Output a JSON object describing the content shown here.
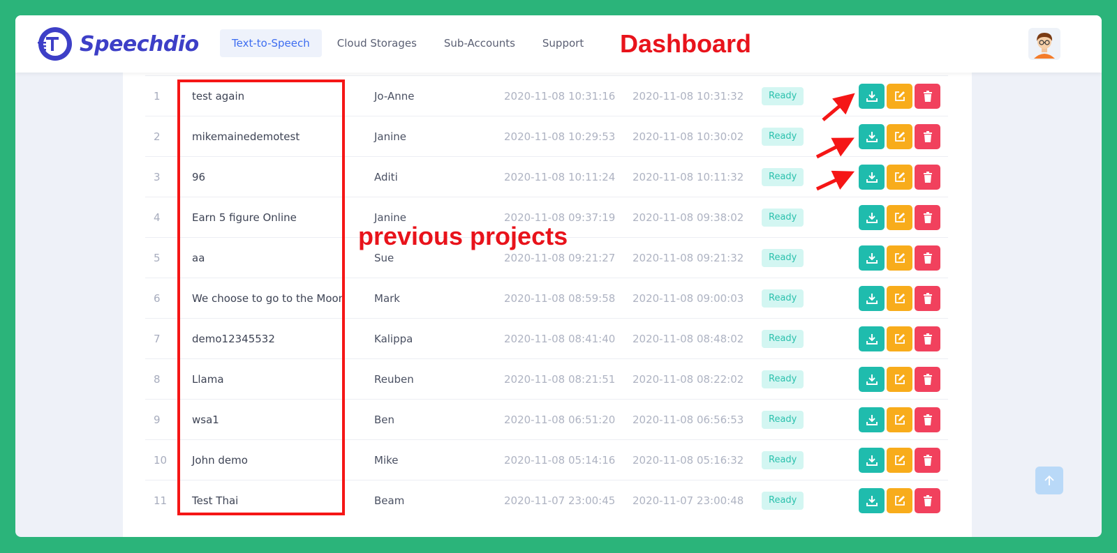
{
  "app": {
    "name": "Speechdio"
  },
  "nav": {
    "items": [
      {
        "label": "Text-to-Speech",
        "active": true
      },
      {
        "label": "Cloud Storages",
        "active": false
      },
      {
        "label": "Sub-Accounts",
        "active": false
      },
      {
        "label": "Support",
        "active": false
      }
    ]
  },
  "annotations": {
    "dashboard": "Dashboard",
    "previous_projects": "previous projects"
  },
  "projects": [
    {
      "num": "1",
      "name": "test again",
      "voice": "Jo-Anne",
      "created": "2020-11-08 10:31:16",
      "updated": "2020-11-08 10:31:32",
      "status": "Ready"
    },
    {
      "num": "2",
      "name": "mikemainedemotest",
      "voice": "Janine",
      "created": "2020-11-08 10:29:53",
      "updated": "2020-11-08 10:30:02",
      "status": "Ready"
    },
    {
      "num": "3",
      "name": "96",
      "voice": "Aditi",
      "created": "2020-11-08 10:11:24",
      "updated": "2020-11-08 10:11:32",
      "status": "Ready"
    },
    {
      "num": "4",
      "name": "Earn 5 figure Online",
      "voice": "Janine",
      "created": "2020-11-08 09:37:19",
      "updated": "2020-11-08 09:38:02",
      "status": "Ready"
    },
    {
      "num": "5",
      "name": "aa",
      "voice": "Sue",
      "created": "2020-11-08 09:21:27",
      "updated": "2020-11-08 09:21:32",
      "status": "Ready"
    },
    {
      "num": "6",
      "name": "We choose to go to the Moon",
      "voice": "Mark",
      "created": "2020-11-08 08:59:58",
      "updated": "2020-11-08 09:00:03",
      "status": "Ready"
    },
    {
      "num": "7",
      "name": "demo12345532",
      "voice": "Kalippa",
      "created": "2020-11-08 08:41:40",
      "updated": "2020-11-08 08:48:02",
      "status": "Ready"
    },
    {
      "num": "8",
      "name": "Llama",
      "voice": "Reuben",
      "created": "2020-11-08 08:21:51",
      "updated": "2020-11-08 08:22:02",
      "status": "Ready"
    },
    {
      "num": "9",
      "name": "wsa1",
      "voice": "Ben",
      "created": "2020-11-08 06:51:20",
      "updated": "2020-11-08 06:56:53",
      "status": "Ready"
    },
    {
      "num": "10",
      "name": "John demo",
      "voice": "Mike",
      "created": "2020-11-08 05:14:16",
      "updated": "2020-11-08 05:16:32",
      "status": "Ready"
    },
    {
      "num": "11",
      "name": "Test Thai",
      "voice": "Beam",
      "created": "2020-11-07 23:00:45",
      "updated": "2020-11-07 23:00:48",
      "status": "Ready"
    }
  ],
  "icons": {
    "download": "download-icon",
    "edit": "edit-icon",
    "delete": "trash-icon",
    "scroll_top": "arrow-up-icon"
  },
  "colors": {
    "background": "#2bb47a",
    "brand": "#3d3fc7",
    "nav_active": "#3d6df0",
    "status_text": "#2bc1ad",
    "status_bg": "#d3f6f2",
    "download_btn": "#1fbcad",
    "edit_btn": "#f8ac1b",
    "delete_btn": "#f1415d",
    "annotation": "#e8131b"
  }
}
